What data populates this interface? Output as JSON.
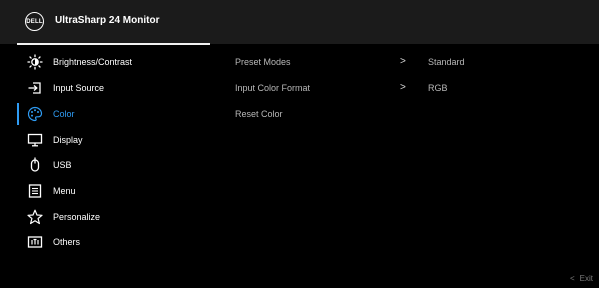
{
  "header": {
    "logo": "DELL",
    "title": "UltraSharp 24 Monitor"
  },
  "sidebar": {
    "items": [
      {
        "label": "Brightness/Contrast",
        "icon": "brightness-icon"
      },
      {
        "label": "Input Source",
        "icon": "input-source-icon"
      },
      {
        "label": "Color",
        "icon": "color-palette-icon",
        "active": true
      },
      {
        "label": "Display",
        "icon": "display-icon"
      },
      {
        "label": "USB",
        "icon": "usb-icon"
      },
      {
        "label": "Menu",
        "icon": "menu-icon"
      },
      {
        "label": "Personalize",
        "icon": "star-icon"
      },
      {
        "label": "Others",
        "icon": "others-icon"
      }
    ]
  },
  "color_menu": {
    "rows": [
      {
        "label": "Preset Modes",
        "arrow": ">",
        "value": "Standard"
      },
      {
        "label": "Input Color Format",
        "arrow": ">",
        "value": "RGB"
      },
      {
        "label": "Reset Color"
      }
    ]
  },
  "footer": {
    "exit_arrow": "<",
    "exit_label": "Exit"
  },
  "colors": {
    "accent": "#2f9cf4",
    "header_bg": "#1b1b1b",
    "background": "#000000"
  }
}
